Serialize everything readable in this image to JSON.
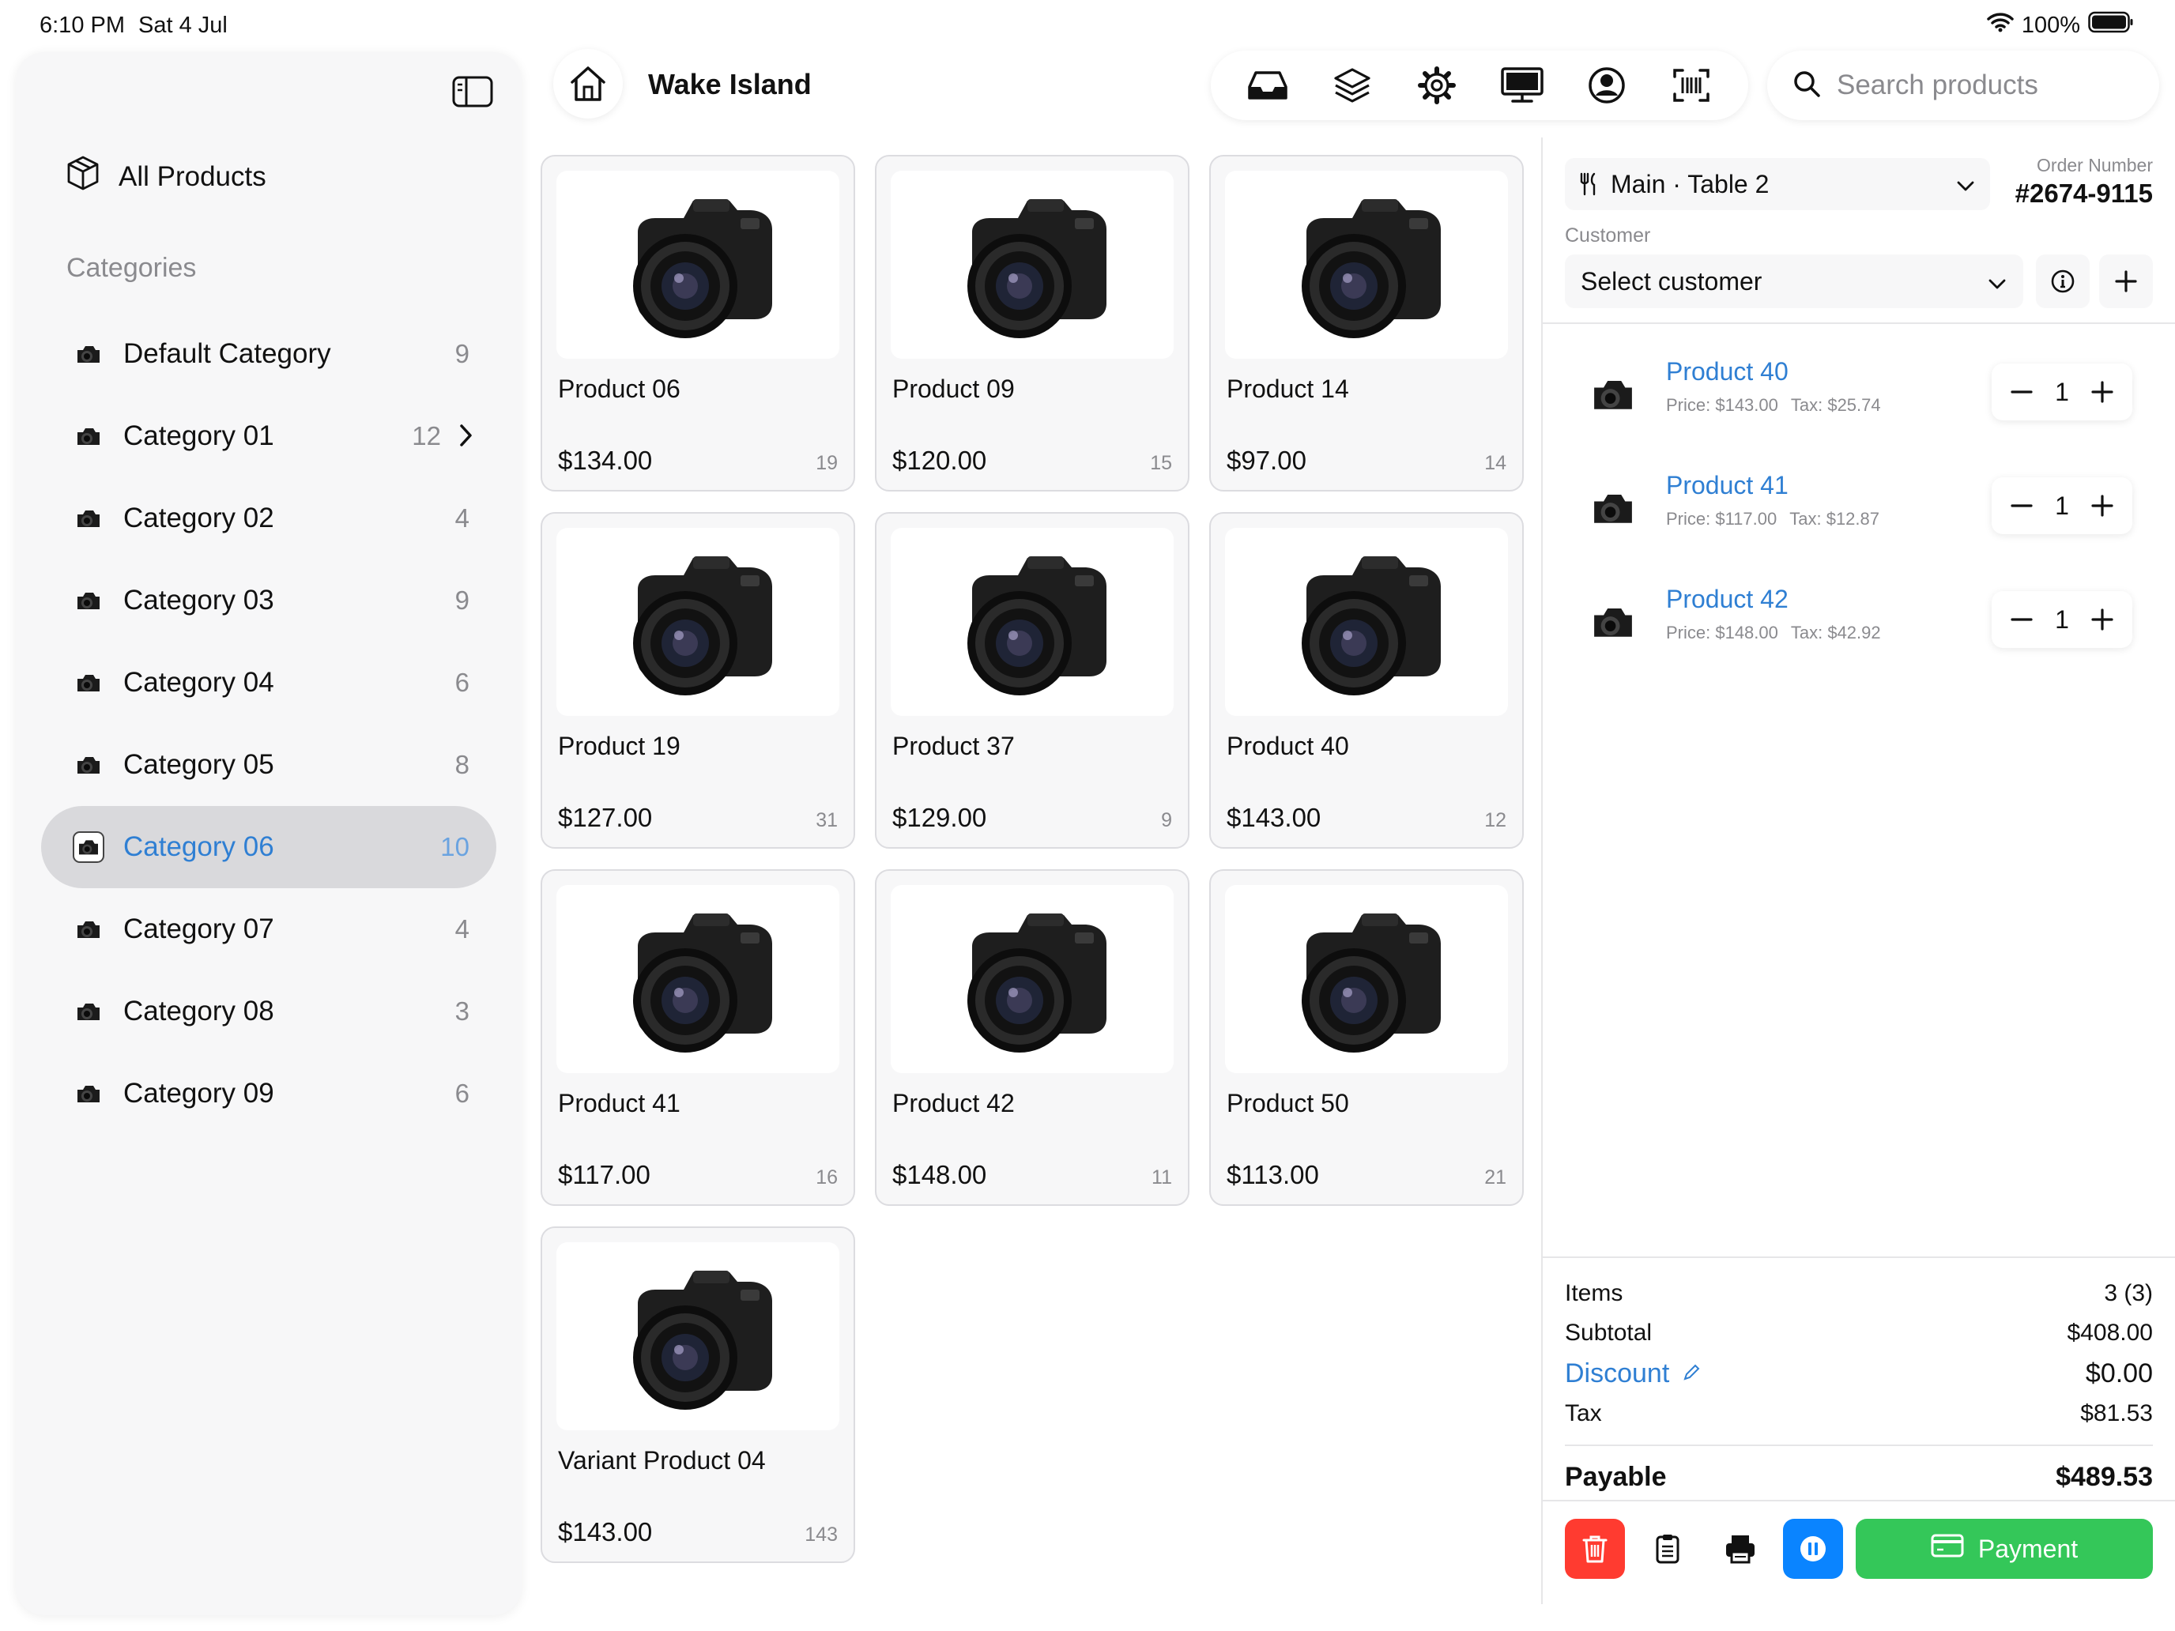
{
  "status_bar": {
    "time": "6:10 PM",
    "date": "Sat 4 Jul",
    "battery": "100%"
  },
  "sidebar": {
    "all_products_label": "All Products",
    "categories_header": "Categories",
    "categories": [
      {
        "label": "Default Category",
        "count": "9"
      },
      {
        "label": "Category 01",
        "count": "12"
      },
      {
        "label": "Category 02",
        "count": "4"
      },
      {
        "label": "Category 03",
        "count": "9"
      },
      {
        "label": "Category 04",
        "count": "6"
      },
      {
        "label": "Category 05",
        "count": "8"
      },
      {
        "label": "Category 06",
        "count": "10"
      },
      {
        "label": "Category 07",
        "count": "4"
      },
      {
        "label": "Category 08",
        "count": "3"
      },
      {
        "label": "Category 09",
        "count": "6"
      }
    ],
    "selected_category": "Category 06"
  },
  "header": {
    "store_name": "Wake Island",
    "toolbar_icons": [
      "inbox-tray-icon",
      "layers-icon",
      "gear-icon",
      "monitor-icon",
      "user-circle-icon",
      "barcode-scan-icon"
    ],
    "search_placeholder": "Search products"
  },
  "products": [
    {
      "name": "Product 06",
      "price": "$134.00",
      "stock": "19"
    },
    {
      "name": "Product 09",
      "price": "$120.00",
      "stock": "15"
    },
    {
      "name": "Product 14",
      "price": "$97.00",
      "stock": "14"
    },
    {
      "name": "Product 19",
      "price": "$127.00",
      "stock": "31"
    },
    {
      "name": "Product 37",
      "price": "$129.00",
      "stock": "9"
    },
    {
      "name": "Product 40",
      "price": "$143.00",
      "stock": "12"
    },
    {
      "name": "Product 41",
      "price": "$117.00",
      "stock": "16"
    },
    {
      "name": "Product 42",
      "price": "$148.00",
      "stock": "11"
    },
    {
      "name": "Product 50",
      "price": "$113.00",
      "stock": "21"
    },
    {
      "name": "Variant Product 04",
      "price": "$143.00",
      "stock": "143"
    }
  ],
  "order": {
    "location": "Main · Table 2",
    "order_number_label": "Order Number",
    "order_number": "#2674-9115",
    "customer_label": "Customer",
    "customer_placeholder": "Select customer",
    "items": [
      {
        "name": "Product 40",
        "price": "Price: $143.00",
        "tax": "Tax: $25.74",
        "qty": "1"
      },
      {
        "name": "Product 41",
        "price": "Price: $117.00",
        "tax": "Tax: $12.87",
        "qty": "1"
      },
      {
        "name": "Product 42",
        "price": "Price: $148.00",
        "tax": "Tax: $42.92",
        "qty": "1"
      }
    ],
    "summary": {
      "items_label": "Items",
      "items_value": "3 (3)",
      "subtotal_label": "Subtotal",
      "subtotal_value": "$408.00",
      "discount_label": "Discount",
      "discount_value": "$0.00",
      "tax_label": "Tax",
      "tax_value": "$81.53",
      "payable_label": "Payable",
      "payable_value": "$489.53"
    },
    "payment_label": "Payment"
  },
  "colors": {
    "accent": "#2f7fd3",
    "delete": "#ff3b30",
    "hold": "#0a84ff",
    "payment": "#34c759"
  }
}
